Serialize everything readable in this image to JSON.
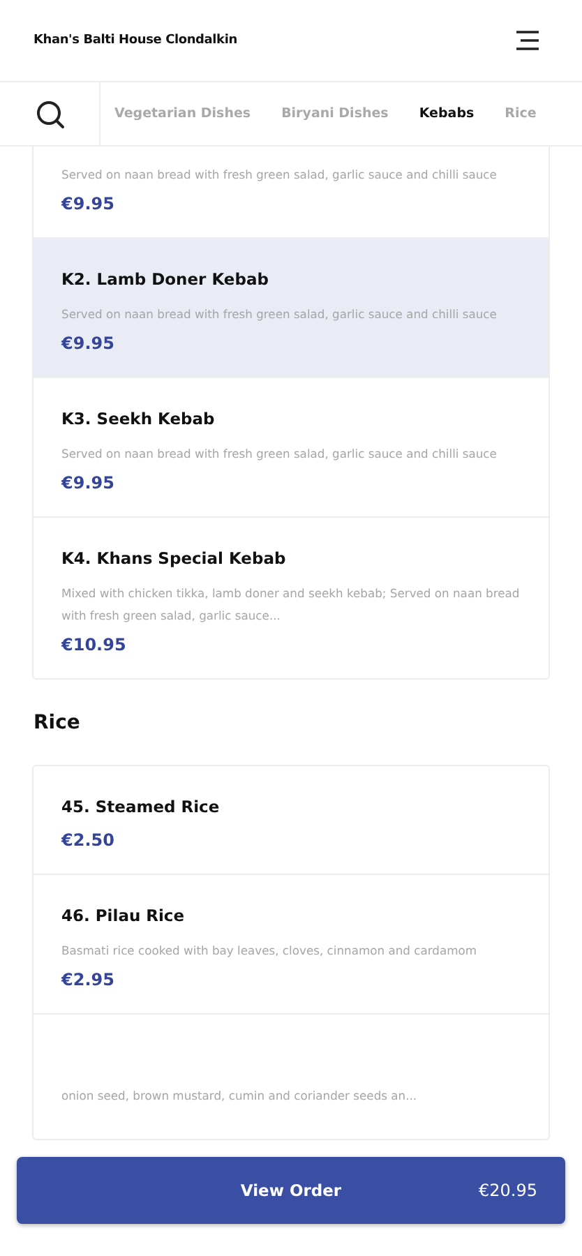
{
  "header": {
    "title": "Khan's Balti House Clondalkin"
  },
  "tabs": [
    {
      "label": "Vegetarian Dishes",
      "selected": false
    },
    {
      "label": "Biryani Dishes",
      "selected": false
    },
    {
      "label": "Kebabs",
      "selected": true
    },
    {
      "label": "Rice",
      "selected": false
    }
  ],
  "sections": [
    {
      "items": [
        {
          "description": "Served on naan bread with fresh green salad, garlic sauce and chilli sauce",
          "price": "€9.95"
        },
        {
          "name": "K2. Lamb Doner Kebab",
          "description": "Served on naan bread with fresh green salad, garlic sauce and chilli sauce",
          "price": "€9.95",
          "selected": true
        },
        {
          "name": "K3. Seekh Kebab",
          "description": "Served on naan bread with fresh green salad, garlic sauce and chilli sauce",
          "price": "€9.95",
          "selected": false
        },
        {
          "name": "K4. Khans Special Kebab",
          "description": "Mixed with chicken tikka, lamb doner and seekh kebab; Served on naan bread with fresh green salad, garlic sauce...",
          "price": "€10.95",
          "selected": false
        }
      ]
    },
    {
      "title": "Rice",
      "items": [
        {
          "name": "45. Steamed Rice",
          "price": "€2.50",
          "selected": false
        },
        {
          "name": "46. Pilau Rice",
          "description": "Basmati rice cooked with bay leaves, cloves, cinnamon and cardamom",
          "price": "€2.95",
          "selected": false
        },
        {
          "description": "onion seed, brown mustard, cumin and coriander seeds an..."
        }
      ]
    }
  ],
  "order_button": {
    "label": "View Order",
    "total": "€20.95"
  }
}
